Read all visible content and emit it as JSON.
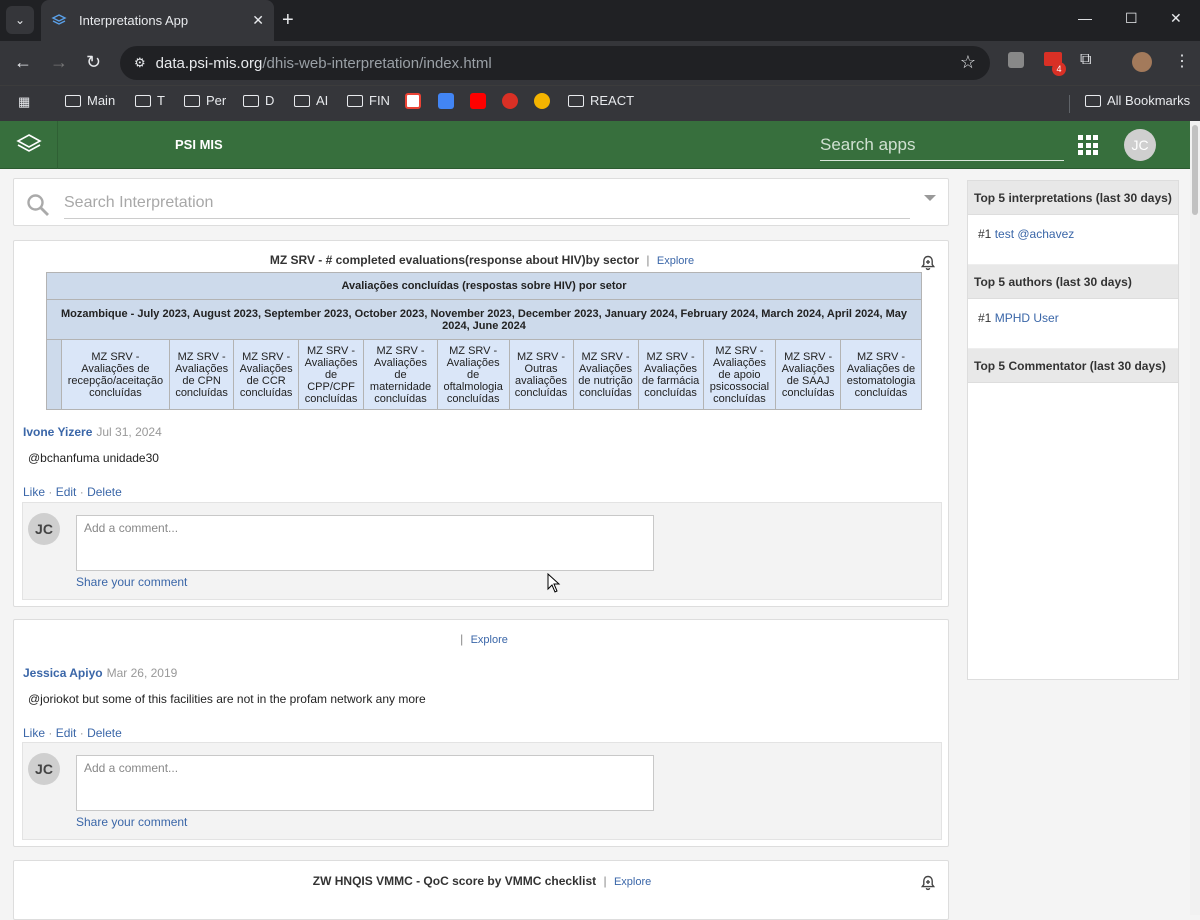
{
  "browser": {
    "tab_title": "Interpretations App",
    "url_host": "data.psi-mis.org",
    "url_path": "/dhis-web-interpretation/index.html",
    "extension_badge": "4",
    "bookmarks": [
      {
        "label": "Main",
        "type": "folder"
      },
      {
        "label": "T",
        "type": "folder"
      },
      {
        "label": "Per",
        "type": "folder"
      },
      {
        "label": "D",
        "type": "folder"
      },
      {
        "label": "AI",
        "type": "folder"
      },
      {
        "label": "FIN",
        "type": "folder"
      },
      {
        "label": "REACT",
        "type": "folder"
      }
    ],
    "all_bookmarks": "All Bookmarks",
    "profile_initials": "JC"
  },
  "header": {
    "app_title": "PSI MIS",
    "search_placeholder": "Search apps",
    "user_initials": "JC",
    "brand_color": "#376f3d"
  },
  "search": {
    "placeholder": "Search Interpretation"
  },
  "interpretations": [
    {
      "favorite_name": "MZ SRV - # completed evaluations(response about HIV)by sector",
      "explore_label": "Explore",
      "separator": "|",
      "table_title": "Avaliações concluídas (respostas sobre HIV) por setor",
      "table_subtitle": "Mozambique - July 2023, August 2023, September 2023, October 2023, November 2023, December 2023, January 2024, February 2024, March 2024, April 2024, May 2024, June 2024",
      "columns": [
        "MZ SRV - Avaliações de recepção/aceitação concluídas",
        "MZ SRV - Avaliações de CPN concluídas",
        "MZ SRV - Avaliações de CCR concluídas",
        "MZ SRV - Avaliações de CPP/CPF concluídas",
        "MZ SRV - Avaliações de maternidade concluídas",
        "MZ SRV - Avaliações de oftalmologia concluídas",
        "MZ SRV - Outras avaliações concluídas",
        "MZ SRV - Avaliações de nutrição concluídas",
        "MZ SRV - Avaliações de farmácia concluídas",
        "MZ SRV - Avaliações de apoio psicossocial concluídas",
        "MZ SRV - Avaliações de SAAJ concluídas",
        "MZ SRV - Avaliações de estomatologia concluídas"
      ],
      "author": "Ivone Yizere",
      "date": "Jul 31, 2024",
      "text": "@bchanfuma unidade30",
      "actions": {
        "like": "Like",
        "edit": "Edit",
        "delete": "Delete",
        "dot": "·"
      },
      "comment_avatar": "JC",
      "comment_placeholder": "Add a comment...",
      "share_label": "Share your comment"
    },
    {
      "favorite_name": "",
      "explore_label": "Explore",
      "separator": "|",
      "author": "Jessica Apiyo",
      "date": "Mar 26, 2019",
      "text": "@joriokot but some of this facilities are not in the profam network any more",
      "actions": {
        "like": "Like",
        "edit": "Edit",
        "delete": "Delete",
        "dot": "·"
      },
      "comment_avatar": "JC",
      "comment_placeholder": "Add a comment...",
      "share_label": "Share your comment"
    },
    {
      "favorite_name": "ZW HNQIS VMMC - QoC score by VMMC checklist",
      "explore_label": "Explore",
      "separator": "|"
    }
  ],
  "sidebar": {
    "top_interpretations_title": "Top 5 interpretations (last 30 days)",
    "top_interpretations": [
      {
        "rank": "#1",
        "label": "test @achavez"
      }
    ],
    "top_authors_title": "Top 5 authors (last 30 days)",
    "top_authors": [
      {
        "rank": "#1",
        "label": "MPHD User"
      }
    ],
    "top_commentators_title": "Top 5 Commentator (last 30 days)"
  }
}
